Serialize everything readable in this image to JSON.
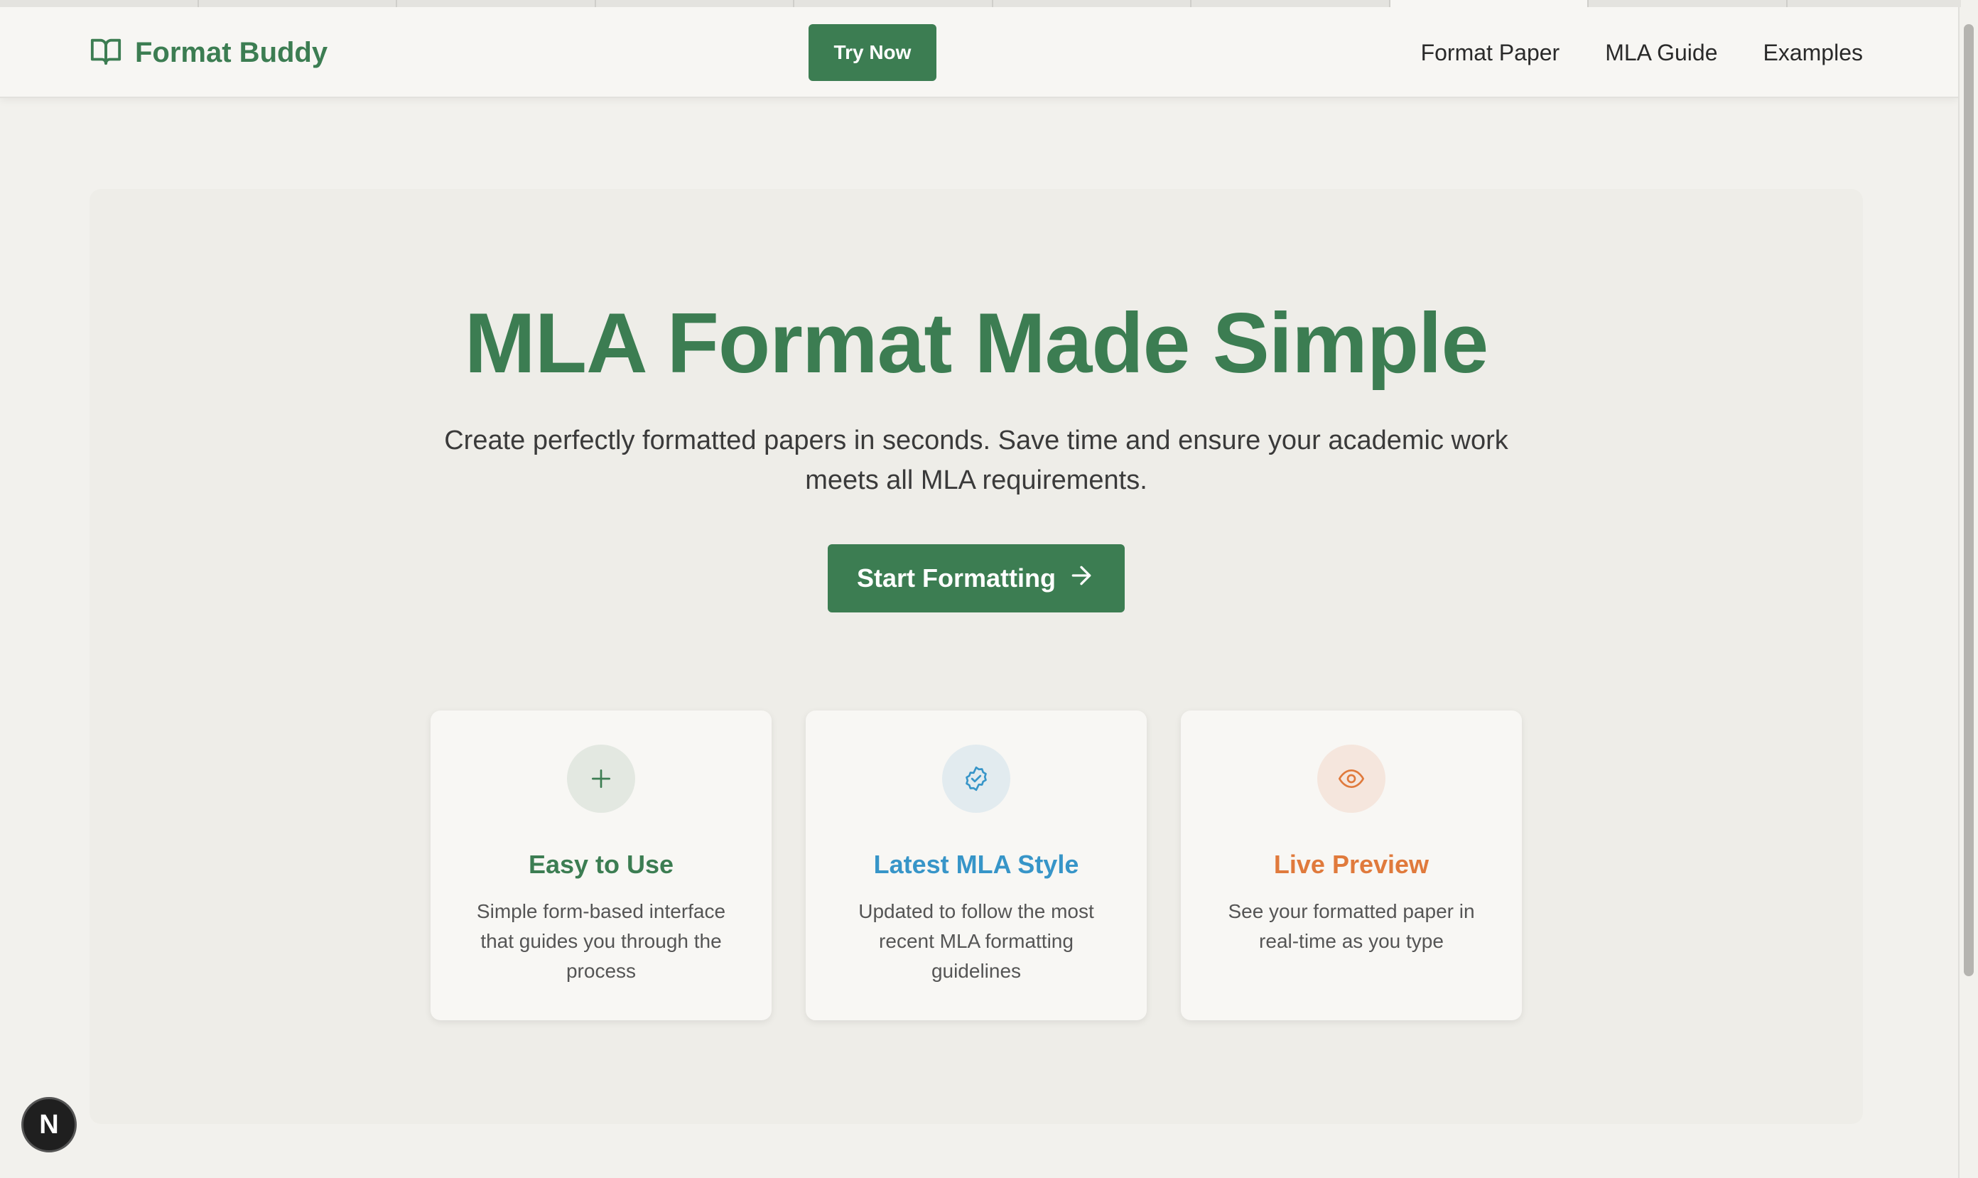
{
  "browser": {
    "tabs": [
      "",
      "",
      "",
      "",
      "",
      "",
      "",
      "",
      "",
      ""
    ],
    "active_tab_index": 7
  },
  "navbar": {
    "brand": {
      "name": "Format Buddy",
      "icon": "book-open-icon"
    },
    "cta_label": "Try Now",
    "links": [
      "Format Paper",
      "MLA Guide",
      "Examples"
    ]
  },
  "hero": {
    "title": "MLA Format Made Simple",
    "subtitle": "Create perfectly formatted papers in seconds. Save time and ensure your academic work meets all MLA requirements.",
    "cta_label": "Start Formatting",
    "cta_icon": "arrow-right-icon"
  },
  "features": [
    {
      "title": "Easy to Use",
      "description": "Simple form-based interface that guides you through the process",
      "icon": "plus-icon",
      "color": "#3c7d52",
      "bg": "#e3e8e1"
    },
    {
      "title": "Latest MLA Style",
      "description": "Updated to follow the most recent MLA formatting guidelines",
      "icon": "badge-check-icon",
      "color": "#3795c8",
      "bg": "#e2ebef"
    },
    {
      "title": "Live Preview",
      "description": "See your formatted paper in real-time as you type",
      "icon": "eye-icon",
      "color": "#e07a3c",
      "bg": "#f5e6dd"
    }
  ],
  "dev_badge": {
    "label": "N"
  },
  "colors": {
    "brand": "#3c7d52",
    "page_bg": "#f2f1ed",
    "hero_bg": "#eeede8"
  }
}
